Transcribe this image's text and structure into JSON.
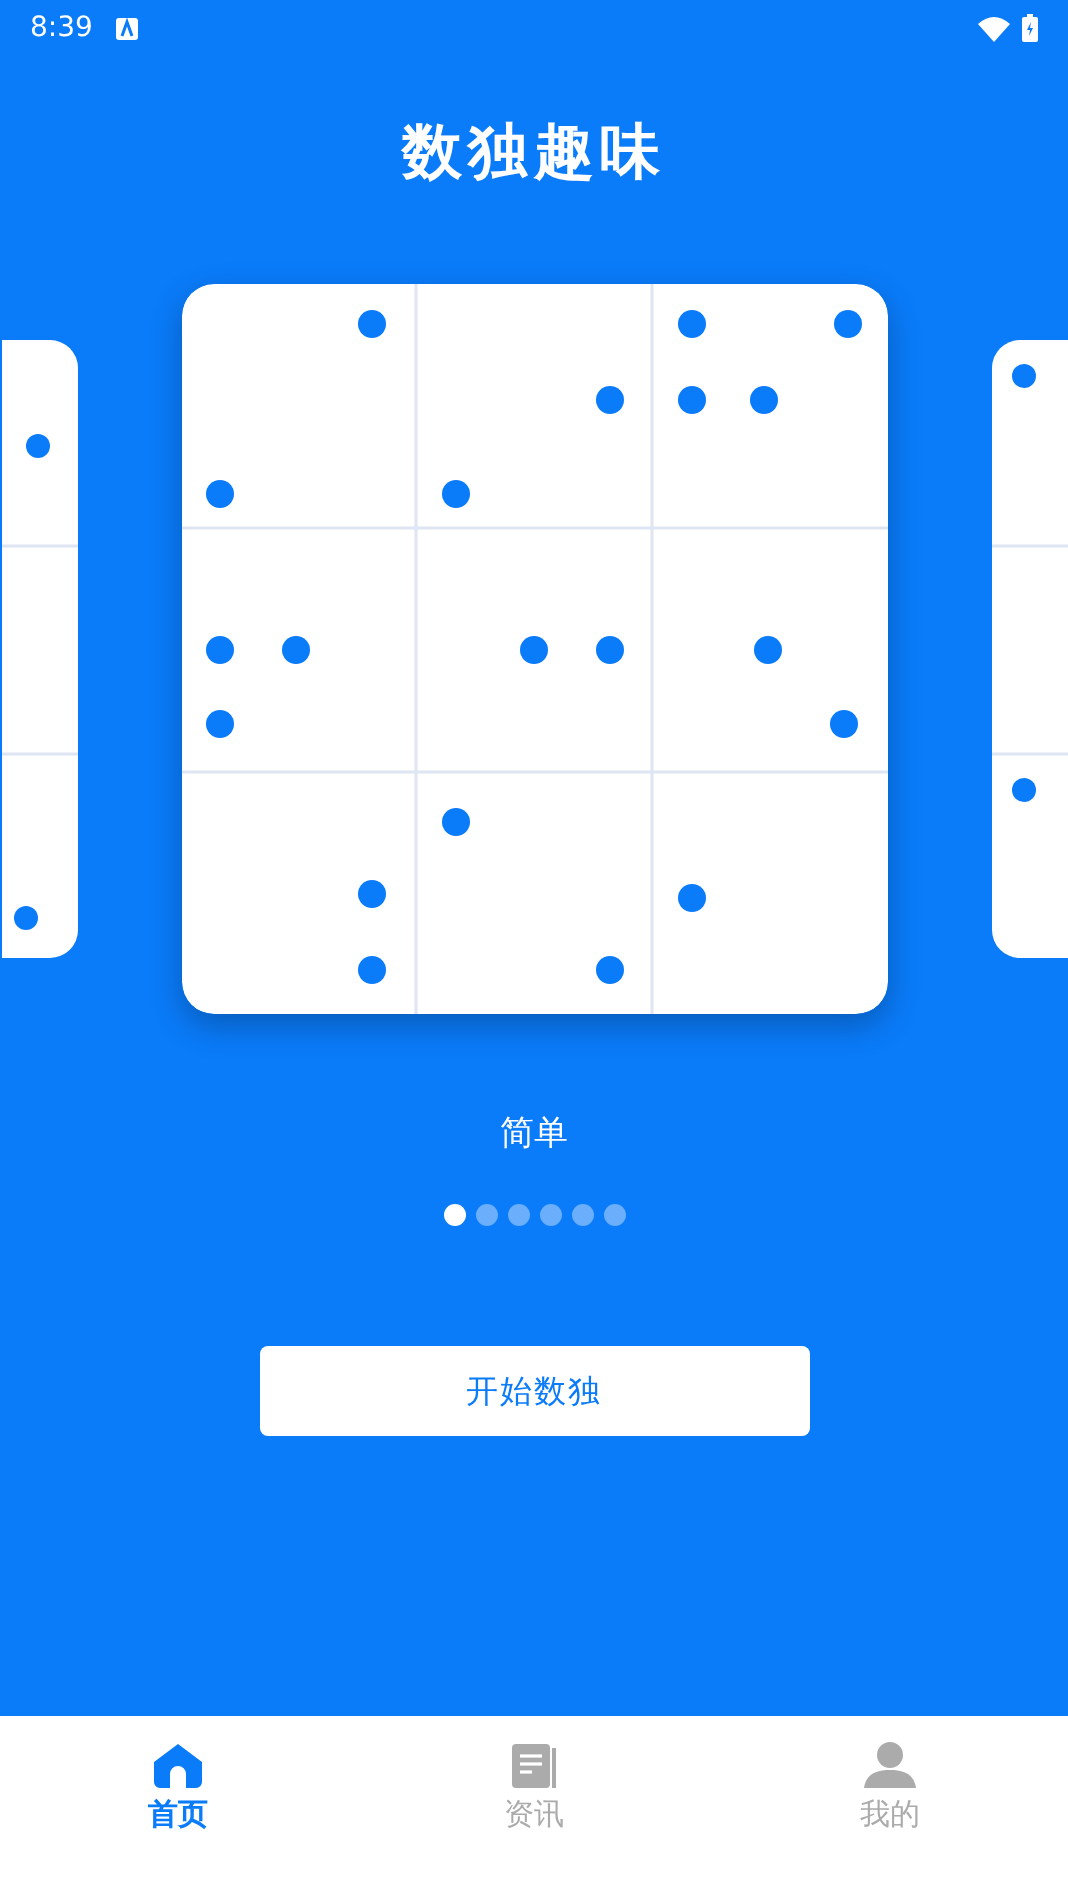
{
  "status_bar": {
    "time": "8:39"
  },
  "title": "数独趣味",
  "carousel": {
    "label": "简单",
    "pages": [
      {
        "selected": true
      },
      {
        "selected": false
      },
      {
        "selected": false
      },
      {
        "selected": false
      },
      {
        "selected": false
      },
      {
        "selected": false
      }
    ]
  },
  "start_button": "开始数独",
  "tabs": [
    {
      "label": "首页",
      "kind": "home",
      "selected": true
    },
    {
      "label": "资讯",
      "kind": "news",
      "selected": false
    },
    {
      "label": "我的",
      "kind": "profile",
      "selected": false
    }
  ]
}
